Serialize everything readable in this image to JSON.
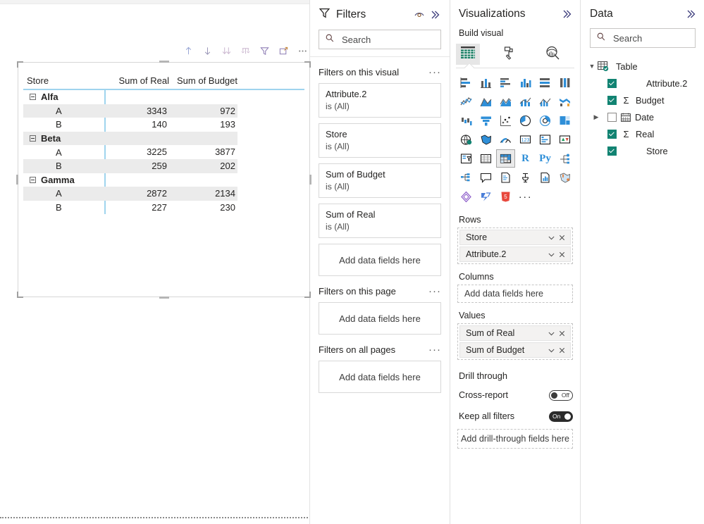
{
  "canvas": {
    "visual": {
      "type": "matrix",
      "toolbar_buttons": [
        {
          "name": "drill-up-icon",
          "label": "Drill up"
        },
        {
          "name": "drill-down-icon",
          "label": "Go to the next level in the hierarchy"
        },
        {
          "name": "expand-all-down-icon",
          "label": "Expand all down one level in the hierarchy"
        },
        {
          "name": "drill-mode-icon",
          "label": "Click to turn on Drill Down"
        },
        {
          "name": "filter-icon",
          "label": "Filters"
        },
        {
          "name": "focus-mode-icon",
          "label": "Focus mode"
        },
        {
          "name": "more-options-icon",
          "label": "More options"
        }
      ],
      "columns": [
        "Store",
        "Sum of Real",
        "Sum of Budget"
      ],
      "rows": [
        {
          "level": 0,
          "label": "Alfa",
          "expanded": true,
          "real": "",
          "budget": "",
          "shaded": false
        },
        {
          "level": 1,
          "label": "A",
          "real": "3343",
          "budget": "972",
          "shaded": true
        },
        {
          "level": 1,
          "label": "B",
          "real": "140",
          "budget": "193",
          "shaded": false
        },
        {
          "level": 0,
          "label": "Beta",
          "expanded": true,
          "real": "",
          "budget": "",
          "shaded": true
        },
        {
          "level": 1,
          "label": "A",
          "real": "3225",
          "budget": "3877",
          "shaded": false
        },
        {
          "level": 1,
          "label": "B",
          "real": "259",
          "budget": "202",
          "shaded": true
        },
        {
          "level": 0,
          "label": "Gamma",
          "expanded": true,
          "real": "",
          "budget": "",
          "shaded": false
        },
        {
          "level": 1,
          "label": "A",
          "real": "2872",
          "budget": "2134",
          "shaded": true
        },
        {
          "level": 1,
          "label": "B",
          "real": "227",
          "budget": "230",
          "shaded": false
        }
      ]
    }
  },
  "filters": {
    "title": "Filters",
    "eye_icon": "eye-icon",
    "collapse_icon": "chevron-double-right-icon",
    "search": {
      "placeholder": "Search",
      "value": ""
    },
    "sections": [
      {
        "title": "Filters on this visual",
        "cards": [
          {
            "name": "Attribute.2",
            "value": "is (All)"
          },
          {
            "name": "Store",
            "value": "is (All)"
          },
          {
            "name": "Sum of Budget",
            "value": "is (All)"
          },
          {
            "name": "Sum of Real",
            "value": "is (All)"
          }
        ],
        "dropzone": "Add data fields here"
      },
      {
        "title": "Filters on this page",
        "cards": [],
        "dropzone": "Add data fields here"
      },
      {
        "title": "Filters on all pages",
        "cards": [],
        "dropzone": "Add data fields here"
      }
    ]
  },
  "visualizations": {
    "title": "Visualizations",
    "collapse_icon": "chevron-double-right-icon",
    "build_label": "Build visual",
    "tabs": [
      {
        "name": "build-visual-tab",
        "icon": "table-build-icon",
        "active": true
      },
      {
        "name": "format-visual-tab",
        "icon": "paint-roller-icon",
        "active": false
      },
      {
        "name": "analytics-tab",
        "icon": "magnifier-chart-icon",
        "active": false
      }
    ],
    "gallery": [
      {
        "name": "stacked-bar-chart-icon",
        "selected": false
      },
      {
        "name": "stacked-column-chart-icon",
        "selected": false
      },
      {
        "name": "clustered-bar-chart-icon",
        "selected": false
      },
      {
        "name": "clustered-column-chart-icon",
        "selected": false
      },
      {
        "name": "100-stacked-bar-chart-icon",
        "selected": false
      },
      {
        "name": "100-stacked-column-chart-icon",
        "selected": false
      },
      {
        "name": "line-chart-icon",
        "selected": false
      },
      {
        "name": "area-chart-icon",
        "selected": false
      },
      {
        "name": "stacked-area-chart-icon",
        "selected": false
      },
      {
        "name": "line-stacked-column-chart-icon",
        "selected": false
      },
      {
        "name": "line-clustered-column-chart-icon",
        "selected": false
      },
      {
        "name": "ribbon-chart-icon",
        "selected": false
      },
      {
        "name": "waterfall-chart-icon",
        "selected": false
      },
      {
        "name": "funnel-chart-icon",
        "selected": false
      },
      {
        "name": "scatter-chart-icon",
        "selected": false
      },
      {
        "name": "pie-chart-icon",
        "selected": false
      },
      {
        "name": "donut-chart-icon",
        "selected": false
      },
      {
        "name": "treemap-icon",
        "selected": false
      },
      {
        "name": "map-icon",
        "selected": false
      },
      {
        "name": "filled-map-icon",
        "selected": false
      },
      {
        "name": "gauge-icon",
        "selected": false
      },
      {
        "name": "card-icon",
        "selected": false
      },
      {
        "name": "multi-row-card-icon",
        "selected": false
      },
      {
        "name": "kpi-icon",
        "selected": false
      },
      {
        "name": "slicer-icon",
        "selected": false
      },
      {
        "name": "table-icon",
        "selected": false
      },
      {
        "name": "matrix-icon",
        "selected": true
      },
      {
        "name": "r-script-visual-icon",
        "label": "R",
        "selected": false
      },
      {
        "name": "python-visual-icon",
        "label": "Py",
        "selected": false
      },
      {
        "name": "key-influencers-icon",
        "selected": false
      },
      {
        "name": "decomposition-tree-icon",
        "selected": false
      },
      {
        "name": "qna-icon",
        "selected": false
      },
      {
        "name": "smart-narrative-icon",
        "selected": false
      },
      {
        "name": "paginated-report-icon",
        "selected": false
      },
      {
        "name": "metrics-icon",
        "selected": false
      },
      {
        "name": "arcgis-maps-icon",
        "selected": false
      },
      {
        "name": "power-apps-icon",
        "selected": false
      },
      {
        "name": "power-automate-icon",
        "selected": false
      },
      {
        "name": "html-viewer-icon",
        "selected": false
      },
      {
        "name": "more-visuals-icon",
        "label": "...",
        "selected": false
      }
    ],
    "wells": [
      {
        "label": "Rows",
        "empty_text": "",
        "fields": [
          "Store",
          "Attribute.2"
        ]
      },
      {
        "label": "Columns",
        "empty_text": "Add data fields here",
        "fields": []
      },
      {
        "label": "Values",
        "empty_text": "",
        "fields": [
          "Sum of Real",
          "Sum of Budget"
        ]
      }
    ],
    "drill": {
      "title": "Drill through",
      "cross_report": {
        "label": "Cross-report",
        "state": "Off",
        "on": false
      },
      "keep_all_filters": {
        "label": "Keep all filters",
        "state": "On",
        "on": true
      },
      "dropzone": "Add drill-through fields here"
    }
  },
  "data": {
    "title": "Data",
    "collapse_icon": "chevron-double-right-icon",
    "search": {
      "placeholder": "Search",
      "value": ""
    },
    "tree": {
      "table_name": "Table",
      "expanded": true,
      "fields": [
        {
          "name": "Attribute.2",
          "checked": true,
          "measure": false,
          "expandable": false,
          "icon": ""
        },
        {
          "name": "Budget",
          "checked": true,
          "measure": true,
          "expandable": false,
          "icon": "sigma"
        },
        {
          "name": "Date",
          "checked": false,
          "measure": false,
          "expandable": true,
          "icon": "calendar"
        },
        {
          "name": "Real",
          "checked": true,
          "measure": true,
          "expandable": false,
          "icon": "sigma"
        },
        {
          "name": "Store",
          "checked": true,
          "measure": false,
          "expandable": false,
          "icon": ""
        }
      ]
    }
  },
  "colors": {
    "accent_green": "#118372",
    "matrix_rule": "#9fd4ee",
    "row_shade": "#ebebeb",
    "chart_blue": "#2f8fd8"
  }
}
